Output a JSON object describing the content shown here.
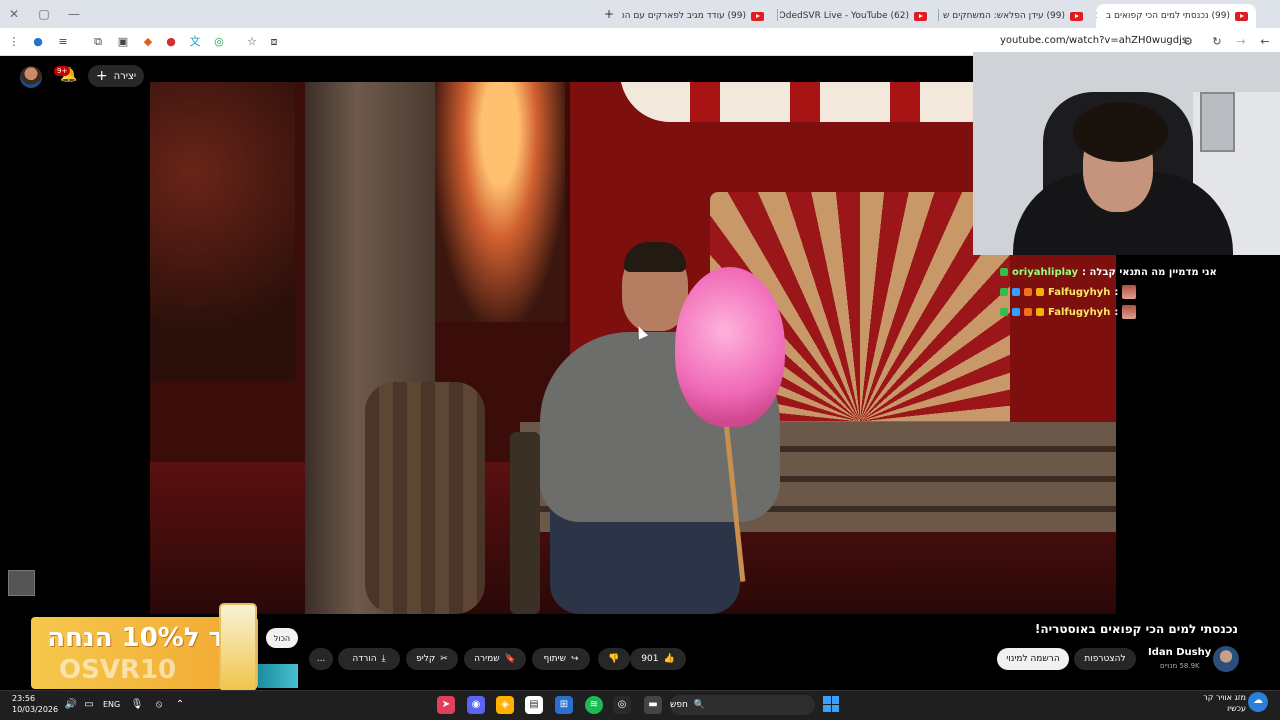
{
  "browser": {
    "tabs": [
      {
        "label": "(99) נכנסתי למים הכי קפואים ב",
        "active": true
      },
      {
        "label": "(99) עידן הפלאש: המשחקים ש",
        "active": false
      },
      {
        "label": "(62) OdedSVR Live - YouTube",
        "active": false
      },
      {
        "label": "(99) עודד מגיב לפארקים עם הכ",
        "active": false
      }
    ],
    "new_tab": "+",
    "url": "youtube.com/watch?v=ahZH0wugdjs"
  },
  "youtube": {
    "create_label": "יצירה",
    "notifications_count": "9+"
  },
  "chat": {
    "rows": [
      {
        "user": "oriyahliplay",
        "message": "אני מדמיין מה התנאי קבלה :"
      },
      {
        "user": "Falfugyhyh",
        "message": ":"
      },
      {
        "user": "Falfugyhyh",
        "message": ":"
      }
    ]
  },
  "video": {
    "title": "נכנסתי למים הכי קפואים באוסטריה!",
    "channel_name": "Idan Dushy",
    "subscribers": "58.9K מנויים",
    "join_label": "להצטרפות",
    "subscribe_label": "הרשמה למינוי",
    "like_count": "901",
    "share_label": "שיתוף",
    "save_label": "שמירה",
    "clip_label": "קליפ",
    "download_label": "הורדה",
    "more_label": "...",
    "all_chip": "הכול"
  },
  "ad": {
    "line1": "קוד ל10% הנחה",
    "line2": "OSVR10"
  },
  "taskbar": {
    "time": "23:56",
    "date": "10/03/2026",
    "language": "ENG",
    "search_placeholder": "חפש",
    "weather_line1": "מזג אוויר קר",
    "weather_line2": "עכשיו"
  },
  "colors": {
    "accent_red": "#cc0000",
    "chat_user_green": "#9aff7a",
    "chat_user_yellow": "#ffe666",
    "ad_yellow": "#f5c84d"
  }
}
